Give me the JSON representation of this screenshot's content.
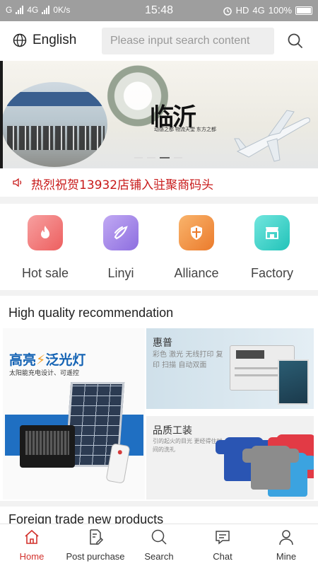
{
  "status_bar": {
    "network_left": "G",
    "network_mid": "4G",
    "speed": "0K/s",
    "time": "15:48",
    "hd": "HD",
    "network_right": "4G",
    "battery": "100%"
  },
  "header": {
    "language": "English",
    "search_placeholder": "Please input search content"
  },
  "banner": {
    "calligraphy": "临沂",
    "tagline": "动感之都 物流天堂 东方之都"
  },
  "notice": {
    "text": "热烈祝贺13932店铺入驻聚商码头"
  },
  "categories": [
    {
      "label": "Hot sale",
      "color": "#f06a6a"
    },
    {
      "label": "Linyi",
      "color": "#9b7be6"
    },
    {
      "label": "Alliance",
      "color": "#ef8b3b"
    },
    {
      "label": "Factory",
      "color": "#3ed3c8"
    }
  ],
  "recommendation": {
    "title": "High quality recommendation",
    "main": {
      "headline": "高亮",
      "headline2": "泛光灯",
      "subtitle": "太阳能充电设计、可遥控"
    },
    "cards": [
      {
        "title": "惠普",
        "sub": "彩色 激光 无线打印 复印 扫描 自动双面"
      },
      {
        "title": "品质工装",
        "sub": "引的起火的目光 更经得住时间的洗礼"
      }
    ]
  },
  "foreign_trade": {
    "title": "Foreign trade new products"
  },
  "tabbar": {
    "tabs": [
      {
        "label": "Home",
        "icon": "home-icon"
      },
      {
        "label": "Post purchase",
        "icon": "edit-document-icon"
      },
      {
        "label": "Search",
        "icon": "search-icon"
      },
      {
        "label": "Chat",
        "icon": "chat-icon"
      },
      {
        "label": "Mine",
        "icon": "user-icon"
      }
    ],
    "active_color": "#d2322d"
  }
}
